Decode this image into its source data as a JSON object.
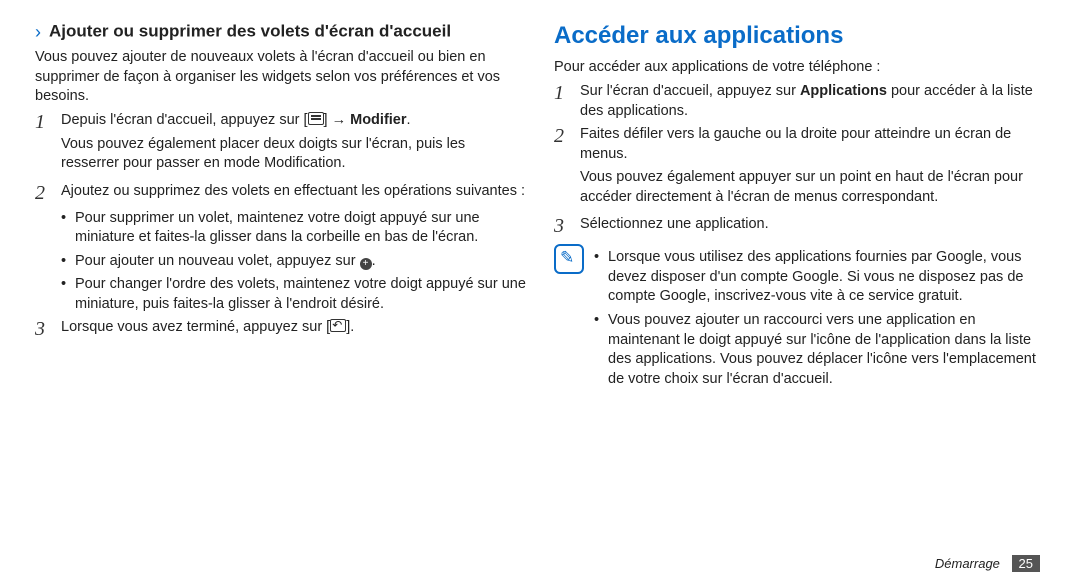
{
  "left": {
    "chevron": "›",
    "heading": "Ajouter ou supprimer des volets d'écran d'accueil",
    "intro": "Vous pouvez ajouter de nouveaux volets à l'écran d'accueil ou bien en supprimer de façon à organiser les widgets selon vos préférences et vos besoins.",
    "step1a": "Depuis l'écran d'accueil, appuyez sur [",
    "step1b": "] → ",
    "step1bold": "Modifier",
    "step1c": ".",
    "step1_extra": "Vous pouvez également placer deux doigts sur l'écran, puis les resserrer pour passer en mode Modification.",
    "step2": "Ajoutez ou supprimez des volets en effectuant les opérations suivantes :",
    "b1": "Pour supprimer un volet, maintenez votre doigt appuyé sur une miniature et faites-la glisser dans la corbeille en bas de l'écran.",
    "b2a": "Pour ajouter un nouveau volet, appuyez sur ",
    "b2b": ".",
    "b3": "Pour changer l'ordre des volets, maintenez votre doigt appuyé sur une miniature, puis faites-la glisser à l'endroit désiré.",
    "step3a": "Lorsque vous avez terminé, appuyez sur [",
    "step3b": "]."
  },
  "right": {
    "heading": "Accéder aux applications",
    "intro": "Pour accéder aux applications de votre téléphone :",
    "step1a": "Sur l'écran d'accueil, appuyez sur ",
    "step1bold": "Applications",
    "step1b": " pour accéder à la liste des applications.",
    "step2": "Faites défiler vers la gauche ou la droite pour atteindre un écran de menus.",
    "step2_extra": "Vous pouvez également appuyer sur un point en haut de l'écran pour accéder directement à l'écran de menus correspondant.",
    "step3": "Sélectionnez une application.",
    "note_b1": "Lorsque vous utilisez des applications fournies par Google, vous devez disposer d'un compte Google. Si vous ne disposez pas de compte Google, inscrivez-vous vite à ce service gratuit.",
    "note_b2": "Vous pouvez ajouter un raccourci vers une application en maintenant le doigt appuyé sur l'icône de l'application dans la liste des applications. Vous pouvez déplacer l'icône vers l'emplacement de votre choix sur l'écran d'accueil."
  },
  "footer": {
    "section": "Démarrage",
    "page": "25"
  }
}
